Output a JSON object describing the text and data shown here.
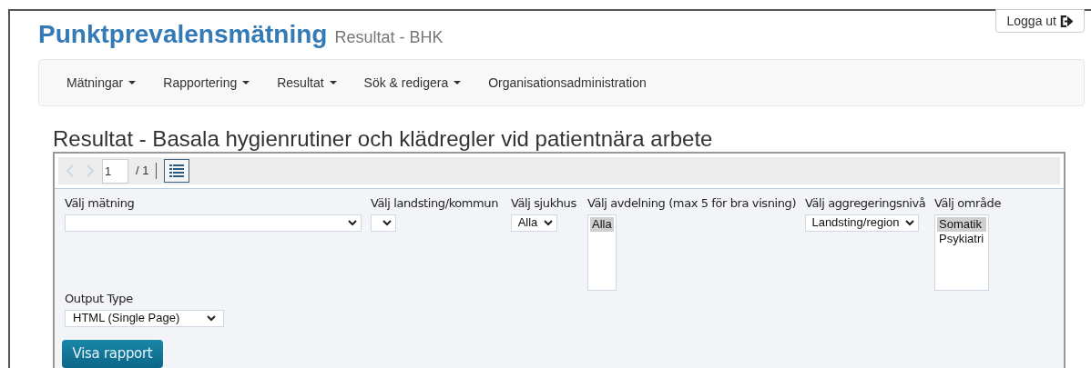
{
  "header": {
    "title": "Punktprevalensmätning",
    "subtitle": "Resultat - BHK",
    "logout": "Logga ut"
  },
  "nav": [
    {
      "label": "Mätningar",
      "dropdown": true
    },
    {
      "label": "Rapportering",
      "dropdown": true
    },
    {
      "label": "Resultat",
      "dropdown": true
    },
    {
      "label": "Sök & redigera",
      "dropdown": true
    },
    {
      "label": "Organisationsadministration",
      "dropdown": false
    }
  ],
  "heading": "Resultat - Basala hygienrutiner och klädregler vid patientnära arbete",
  "toolbar": {
    "page": "1",
    "total": "/ 1",
    "prev_disabled": true,
    "next_disabled": true
  },
  "parameters": [
    {
      "kind": "select",
      "label": "Välj mätning"
    },
    {
      "kind": "select",
      "label": "Välj landsting/kommun"
    },
    {
      "kind": "select",
      "label": "Välj sjukhus",
      "value": "Alla"
    },
    {
      "kind": "listbox",
      "label": "Välj avdelning (max 5 för bra visning)",
      "options": [
        {
          "label": "Alla",
          "selected": true
        }
      ]
    },
    {
      "kind": "select",
      "label": "Välj aggregeringsnivå",
      "value": "Landsting/region"
    },
    {
      "kind": "listbox",
      "label": "Välj område",
      "options": [
        {
          "label": "Somatik",
          "selected": true
        },
        {
          "label": "Psykiatri",
          "selected": false
        }
      ]
    }
  ],
  "output_type": {
    "label": "Output Type",
    "value": "HTML (Single Page)"
  },
  "submit": "Visa rapport"
}
